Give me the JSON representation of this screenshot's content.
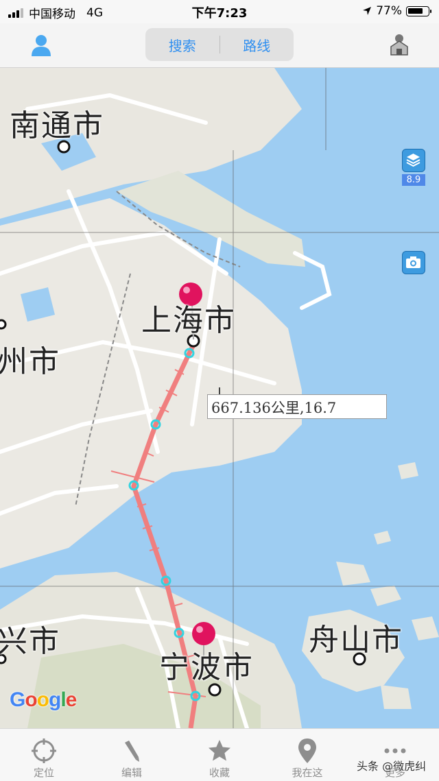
{
  "status_bar": {
    "carrier": "中国移动",
    "network": "4G",
    "time": "下午7:23",
    "battery_percent": 0.77,
    "battery_text": "77%"
  },
  "nav": {
    "profile_icon": "user-icon",
    "search_tab": "搜索",
    "route_tab": "路线",
    "settings_icon": "home-user-icon"
  },
  "map": {
    "labels": {
      "nantong": "南通市",
      "shanghai": "上海市",
      "suzhou_partial": "州市",
      "jiaxing_partial": "兴市",
      "ningbo": "宁波市",
      "zhoushan": "舟山市"
    },
    "layers_icon": "layers-icon",
    "zoom_level": "8.9",
    "camera_icon": "camera-icon",
    "distance_readout": "667.136公里,16.7",
    "google_logo": "Google",
    "pin_color": "#e0135e",
    "route_color": "#f07f7f",
    "water_color": "#9ecdf2"
  },
  "tabs": [
    {
      "label": "定位",
      "icon": "crosshair-icon"
    },
    {
      "label": "编辑",
      "icon": "pencil-icon"
    },
    {
      "label": "收藏",
      "icon": "star-icon"
    },
    {
      "label": "我在这",
      "icon": "location-pin-icon"
    },
    {
      "label": "更多",
      "icon": "more-icon"
    }
  ],
  "watermark": "头条 @微虎纠"
}
